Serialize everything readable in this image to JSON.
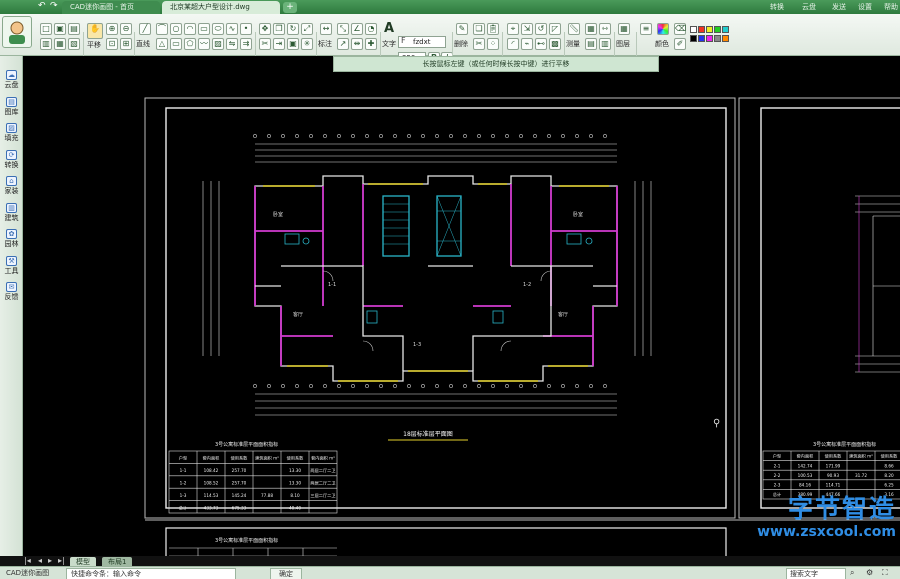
{
  "titlebar": {
    "tabs": [
      {
        "label": "CAD迷你画图 - 首页"
      },
      {
        "label": "北京某超大户型设计.dwg"
      }
    ],
    "add_tab": "+",
    "links": [
      {
        "label": "转换"
      },
      {
        "label": "云盘"
      },
      {
        "label": "发送"
      },
      {
        "label": "设置"
      },
      {
        "label": "帮助"
      }
    ]
  },
  "ribbon": {
    "groups": [
      {
        "label": "平移"
      },
      {
        "label": "直线"
      },
      {
        "label": "标注"
      },
      {
        "label": "文字"
      },
      {
        "label": "删除"
      },
      {
        "label": "测量"
      },
      {
        "label": "图层"
      },
      {
        "label": "颜色"
      }
    ],
    "font_name": "fzdxt",
    "font_size": "350",
    "bold": "B",
    "italic": "I",
    "text_tool_icon": "A"
  },
  "hint": "长按鼠标左键（或任何时候长按中键）进行平移",
  "sidebar": {
    "items": [
      {
        "label": "云盘",
        "icon": "cloud-icon"
      },
      {
        "label": "图库",
        "icon": "library-icon"
      },
      {
        "label": "填充",
        "icon": "fill-icon"
      },
      {
        "label": "转换",
        "icon": "convert-icon"
      },
      {
        "label": "家装",
        "icon": "home-icon"
      },
      {
        "label": "建筑",
        "icon": "building-icon"
      },
      {
        "label": "园林",
        "icon": "garden-icon"
      },
      {
        "label": "工具",
        "icon": "tool-icon"
      },
      {
        "label": "反馈",
        "icon": "mail-icon"
      }
    ]
  },
  "drawing": {
    "plan_title": "18层标准层平面图",
    "table_left_title": "3号公寓标准层平面面积指标",
    "table_left_title2": "3号公寓标准层平面面积指标",
    "table_right_title": "3号公寓标准层平面面积指标",
    "table_headers": [
      "户型",
      "套内面积",
      "使用系数",
      "建筑面积 m²",
      "使用系数",
      "套内面积 m²",
      "户型房"
    ],
    "table_rows": [
      [
        "1-1",
        "108.42",
        "257.70",
        "",
        "13.30",
        "两居二厅二卫"
      ],
      [
        "1-2",
        "108.52",
        "257.70",
        "",
        "13.30",
        "两居二厅二卫"
      ],
      [
        "1-3",
        "114.53",
        "145.24",
        "77.88",
        "8.10",
        "三居二厅二卫"
      ],
      [
        "总计",
        "433.73",
        "675.33",
        "",
        "40.40",
        ""
      ]
    ],
    "table_right_rows": [
      [
        "2-1",
        "142.74",
        "171.99",
        "",
        "8.66"
      ],
      [
        "2-2",
        "100.53",
        "90.93",
        "31.72",
        "8.20"
      ],
      [
        "2-3",
        "84.16",
        "114.71",
        "",
        "6.25"
      ],
      [
        "总计",
        "380.99",
        "447.66",
        "",
        "3.16"
      ]
    ]
  },
  "layout_tabs": [
    {
      "label": "模型"
    },
    {
      "label": "布局1"
    }
  ],
  "status": {
    "app_label": "CAD迷你画图",
    "command_placeholder": "快捷命令条：输入命令",
    "center_button": "确定",
    "right_label": "搜索文字"
  },
  "watermark": {
    "big": "字节智造",
    "small": "www.zsxcool.com"
  },
  "colors": {
    "accent": "#2e7a3e",
    "canvas": "#000000",
    "line_white": "#e6e6e6",
    "wall_magenta": "#d23cd0",
    "stair_cyan": "#2ab5c9",
    "window_yellow": "#e3d12b"
  }
}
